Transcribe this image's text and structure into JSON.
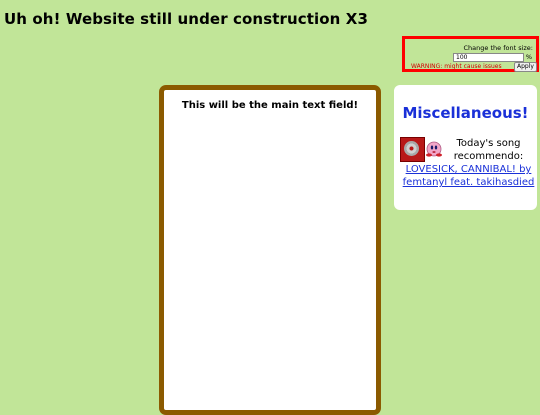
{
  "header": {
    "title": "Uh oh! Website still under construction X3"
  },
  "font_control": {
    "label": "Change the font size:",
    "value": "100",
    "unit": "%",
    "warning": "WARNING: might cause issues",
    "apply_label": "Apply",
    "border_color": "#ff0000"
  },
  "main": {
    "text": "This will be the main text field!",
    "border_color": "#8b5a00"
  },
  "misc": {
    "title": "Miscellaneous!",
    "intro_line1": "Today's song",
    "intro_line2": "recommendo:",
    "song_link": "LOVESICK, CANNIBAL! by femtanyl feat. takihasdied",
    "icons": [
      "cd-icon",
      "kirby-icon"
    ]
  },
  "colors": {
    "background": "#c1e598",
    "link": "#1a30d8",
    "title_blue": "#1a30d8"
  }
}
